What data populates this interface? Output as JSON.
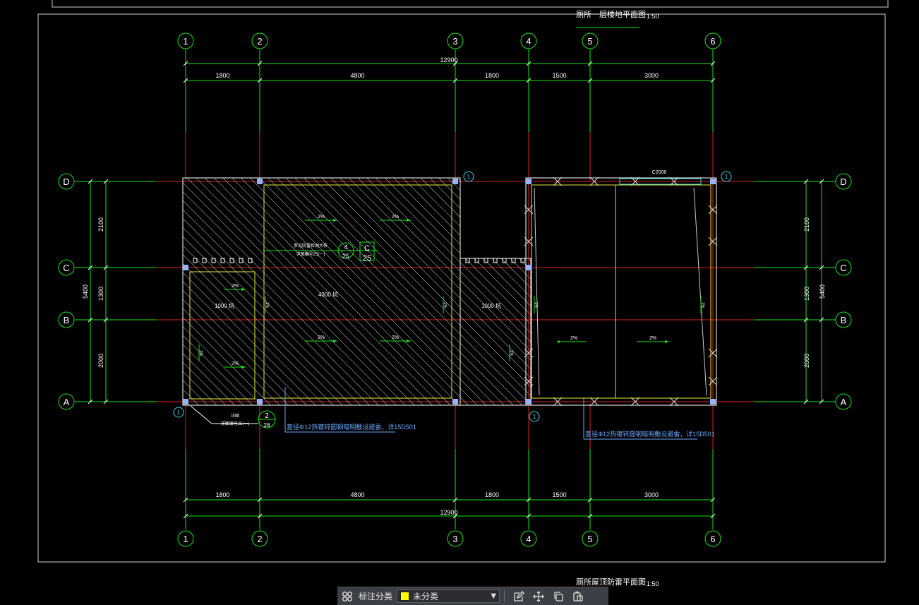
{
  "drawing": {
    "title_top": "厕所一层楼地平面图",
    "title_bottom": "厕所屋顶防雷平面图",
    "scale": "1:50",
    "axes_x": [
      "1",
      "2",
      "3",
      "4",
      "5",
      "6"
    ],
    "axes_y": [
      "D",
      "C",
      "B",
      "A"
    ],
    "dims_top": [
      "1800",
      "4800",
      "1800",
      "1500",
      "3000"
    ],
    "dims_bottom": [
      "1800",
      "4800",
      "1800",
      "1500",
      "3000"
    ],
    "total_width": "12900",
    "dims_side": [
      "2100",
      "1300",
      "2000"
    ],
    "total_height": "5400",
    "window_tag": "C2006",
    "section_tag_right": "1",
    "note_1": "直径Φ12热镀锌圆钢暗明敷设避雷，详15D501",
    "note_2": "直径Φ12热镀锌圆钢暗明敷设避雷，详15D501",
    "detail_upper": "2",
    "detail_lower": "28",
    "detail_text": "详图",
    "detail_ref": "详图编号25(一)",
    "callout_num": "4",
    "callout_sheet": "25",
    "callout_letter": "C",
    "callout_sheet2": "25",
    "callout_text_1": "参见防雷检测大样",
    "callout_text_2": "详图编号25(一)",
    "slope_labels": [
      "1%",
      "2%",
      "2%",
      "2%",
      "2%",
      "2%",
      "2%",
      "2%",
      "2%"
    ],
    "room_labels": [
      "1000 坑",
      "4300 坑",
      "1000 坑"
    ],
    "colors": {
      "axis_green": "#19e619",
      "grid_red": "#e02020",
      "hatch": "#d8d8d8",
      "callout_cyan": "#3ad7e8",
      "wall_yellow": "#e8e83a",
      "note_blue": "#6aa8ff"
    }
  },
  "toolbar": {
    "grid_icon": "grid-icon",
    "label": "标注分类",
    "selected": "未分类",
    "selected_color": "#ffff00",
    "icons": [
      "edit-icon",
      "move-icon",
      "copy-icon",
      "paste-icon"
    ]
  }
}
